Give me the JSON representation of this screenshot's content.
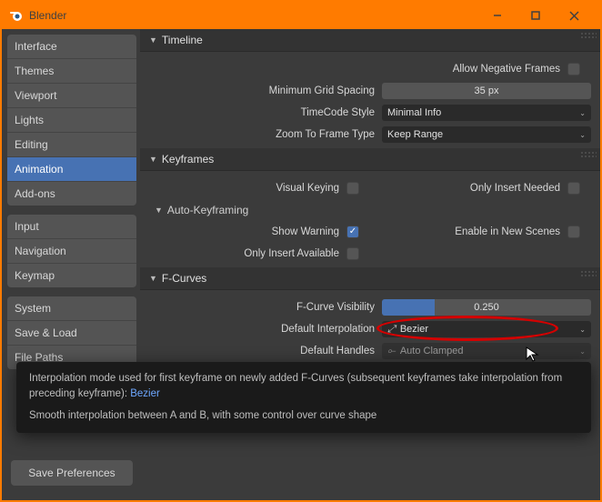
{
  "window": {
    "title": "Blender"
  },
  "sidebar": {
    "groups": [
      [
        "Interface",
        "Themes",
        "Viewport",
        "Lights",
        "Editing",
        "Animation",
        "Add-ons"
      ],
      [
        "Input",
        "Navigation",
        "Keymap"
      ],
      [
        "System",
        "Save & Load",
        "File Paths"
      ]
    ],
    "selected": "Animation",
    "save_button": "Save Preferences"
  },
  "panels": {
    "timeline": {
      "title": "Timeline",
      "allow_neg": "Allow Negative Frames",
      "min_grid_lab": "Minimum Grid Spacing",
      "min_grid_val": "35 px",
      "timecode_lab": "TimeCode Style",
      "timecode_val": "Minimal Info",
      "zoom_lab": "Zoom To Frame Type",
      "zoom_val": "Keep Range"
    },
    "keyframes": {
      "title": "Keyframes",
      "visual": "Visual Keying",
      "only_needed": "Only Insert Needed",
      "auto_header": "Auto-Keyframing",
      "show_warn": "Show Warning",
      "enable_new": "Enable in New Scenes",
      "only_avail": "Only Insert Available"
    },
    "fcurves": {
      "title": "F-Curves",
      "vis_lab": "F-Curve Visibility",
      "vis_val": "0.250",
      "vis_fill_pct": 25,
      "interp_lab": "Default Interpolation",
      "interp_val": "Bezier",
      "handles_lab": "Default Handles",
      "handles_val": "Auto Clamped"
    }
  },
  "tooltip": {
    "line1_a": "Interpolation mode used for first keyframe on newly added F-Curves (subsequent keyframes take interpolation from preceding keyframe): ",
    "line1_b": "Bezier",
    "line2": "Smooth interpolation between A and B, with some control over curve shape"
  }
}
